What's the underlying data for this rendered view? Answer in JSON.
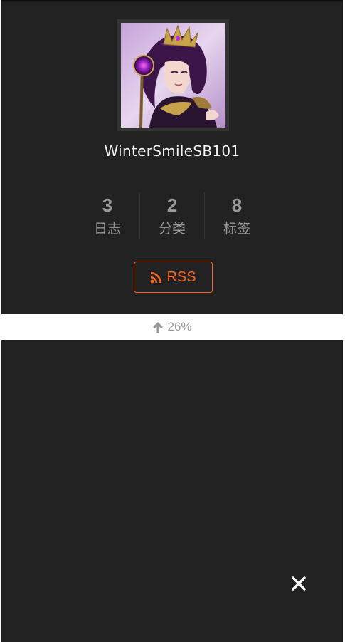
{
  "author": {
    "name": "WinterSmileSB101",
    "avatar_icon": "avatar-anime-character"
  },
  "stats": [
    {
      "count": "3",
      "label": "日志"
    },
    {
      "count": "2",
      "label": "分类"
    },
    {
      "count": "8",
      "label": "标签"
    }
  ],
  "rss": {
    "label": "RSS",
    "icon": "rss-icon"
  },
  "back_to_top": {
    "percent": "26%",
    "icon": "arrow-up-icon"
  },
  "close": {
    "icon": "close-icon"
  },
  "colors": {
    "sidebar_bg": "#222222",
    "accent": "#fc6423",
    "muted_text": "#999999",
    "name_text": "#f5f5f5"
  }
}
